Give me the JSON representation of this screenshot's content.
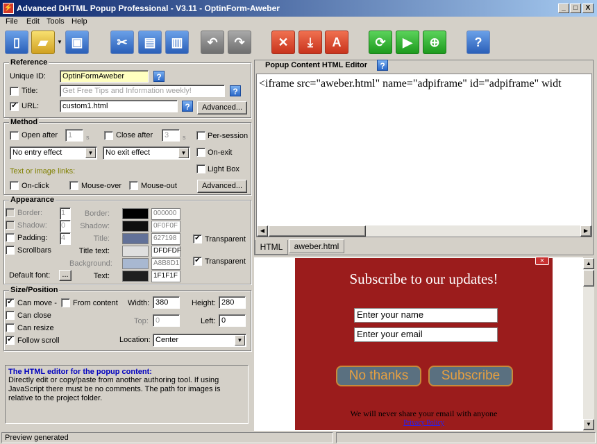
{
  "window": {
    "title": "Advanced DHTML Popup Professional - V3.11 - OptinForm-Aweber",
    "min_glyph": "_",
    "max_glyph": "□",
    "close_glyph": "X"
  },
  "menu": [
    "File",
    "Edit",
    "Tools",
    "Help"
  ],
  "reference": {
    "heading": "Reference",
    "unique_id_label": "Unique ID:",
    "unique_id_value": "OptinFormAweber",
    "title_label": "Title:",
    "title_placeholder": "Get Free Tips and Information weekly!",
    "title_checked": false,
    "url_label": "URL:",
    "url_value": "custom1.html",
    "url_checked": true,
    "advanced_label": "Advanced..."
  },
  "method": {
    "heading": "Method",
    "open_after_label": "Open after",
    "open_after_value": "1",
    "close_after_label": "Close after",
    "close_after_value": "3",
    "seconds_unit": "s",
    "per_session_label": "Per-session",
    "on_exit_label": "On-exit",
    "light_box_label": "Light Box",
    "entry_effect": "No entry effect",
    "exit_effect": "No exit effect",
    "links_label": "Text or image links:",
    "on_click_label": "On-click",
    "mouse_over_label": "Mouse-over",
    "mouse_out_label": "Mouse-out",
    "advanced_label": "Advanced..."
  },
  "appearance": {
    "heading": "Appearance",
    "border_label": "Border:",
    "border_value": "1",
    "shadow_label": "Shadow:",
    "shadow_value": "0",
    "padding_label": "Padding:",
    "padding_value": "4",
    "padding_checked": false,
    "scrollbars_label": "Scrollbars",
    "default_font_label": "Default font:",
    "font_button": "...",
    "colors": [
      {
        "label": "Border:",
        "hex": "000000",
        "color": "#000000",
        "disabled": true
      },
      {
        "label": "Shadow:",
        "hex": "0F0F0F",
        "color": "#0F0F0F",
        "disabled": true
      },
      {
        "label": "Title:",
        "hex": "627198",
        "color": "#627198",
        "disabled": true
      },
      {
        "label": "Title text:",
        "hex": "DFDFDF",
        "color": "#DFDFDF",
        "disabled": false
      },
      {
        "label": "Background:",
        "hex": "A8B8D1",
        "color": "#A8B8D1",
        "disabled": true
      },
      {
        "label": "Text:",
        "hex": "1F1F1F",
        "color": "#1F1F1F",
        "disabled": false
      }
    ],
    "transparent_label": "Transparent",
    "transparent1_checked": true,
    "transparent2_checked": true
  },
  "size": {
    "heading": "Size/Position",
    "can_move_label": "Can  move -",
    "can_move_checked": true,
    "from_content_label": "From content",
    "can_close_label": "Can close",
    "can_resize_label": "Can resize",
    "follow_scroll_label": "Follow scroll",
    "follow_scroll_checked": true,
    "width_label": "Width:",
    "width_value": "380",
    "height_label": "Height:",
    "height_value": "280",
    "top_label": "Top:",
    "top_value": "0",
    "left_label": "Left:",
    "left_value": "0",
    "location_label": "Location:",
    "location_value": "Center"
  },
  "info": {
    "title": "The HTML editor for the popup content:",
    "body": "Directly edit or copy/paste from another authoring tool. If using JavaScript there must be no comments. The path for images is relative to the project folder."
  },
  "editor": {
    "heading": "Popup Content HTML Editor",
    "code": "<iframe src=\"aweber.html\" name=\"adpiframe\" id=\"adpiframe\" widt",
    "tabs": [
      "HTML",
      "aweber.html"
    ]
  },
  "preview": {
    "heading": "Subscribe to our updates!",
    "name_placeholder": "Enter your name",
    "email_placeholder": "Enter your email",
    "no_thanks": "No thanks",
    "subscribe": "Subscribe",
    "disclaimer": "We will never share your email with anyone",
    "privacy": "Privacy Policy",
    "close_glyph": "×"
  },
  "status": {
    "text": "Preview generated"
  }
}
